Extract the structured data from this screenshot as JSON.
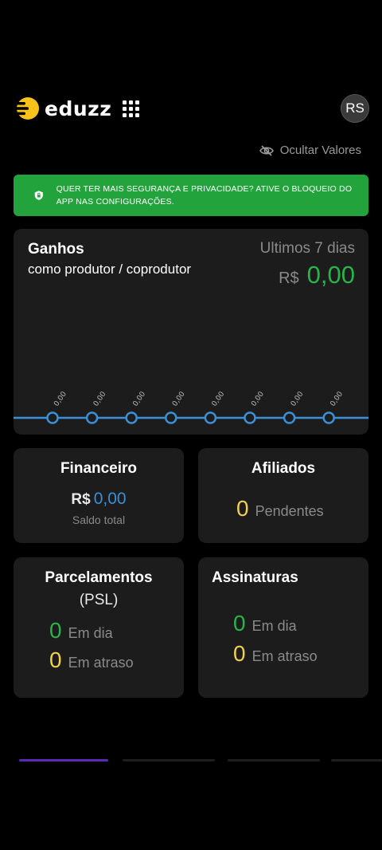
{
  "header": {
    "brand": "eduzz",
    "avatar_initials": "RS",
    "brand_color": "#f6c21b"
  },
  "hide_values": {
    "label": "Ocultar Valores",
    "icon": "eye-slash-icon"
  },
  "alert": {
    "text": "QUER TER MAIS SEGURANÇA E PRIVACIDADE? ATIVE O BLOQUEIO DO APP NAS CONFIGURAÇÕES.",
    "icon": "shield-lock-icon",
    "color": "#22a33c"
  },
  "earnings": {
    "title": "Ganhos",
    "subtitle": "como produtor / coprodutor",
    "period": "Ultimos 7 dias",
    "currency": "R$",
    "value": "0,00"
  },
  "chart_data": {
    "type": "line",
    "values": [
      0,
      0,
      0,
      0,
      0,
      0,
      0,
      0
    ],
    "data_labels": [
      "0,00",
      "0,00",
      "0,00",
      "0,00",
      "0,00",
      "0,00",
      "0,00",
      "0,00"
    ],
    "line_color": "#3a8fd6"
  },
  "financeiro": {
    "title": "Financeiro",
    "currency": "R$",
    "value": "0,00",
    "label": "Saldo total"
  },
  "afiliados": {
    "title": "Afiliados",
    "count": "0",
    "label": "Pendentes"
  },
  "parcelamentos": {
    "title": "Parcelamentos",
    "subtitle": "(PSL)",
    "on_time_count": "0",
    "on_time_label": "Em dia",
    "late_count": "0",
    "late_label": "Em atraso"
  },
  "assinaturas": {
    "title": "Assinaturas",
    "on_time_count": "0",
    "on_time_label": "Em dia",
    "late_count": "0",
    "late_label": "Em atraso"
  }
}
